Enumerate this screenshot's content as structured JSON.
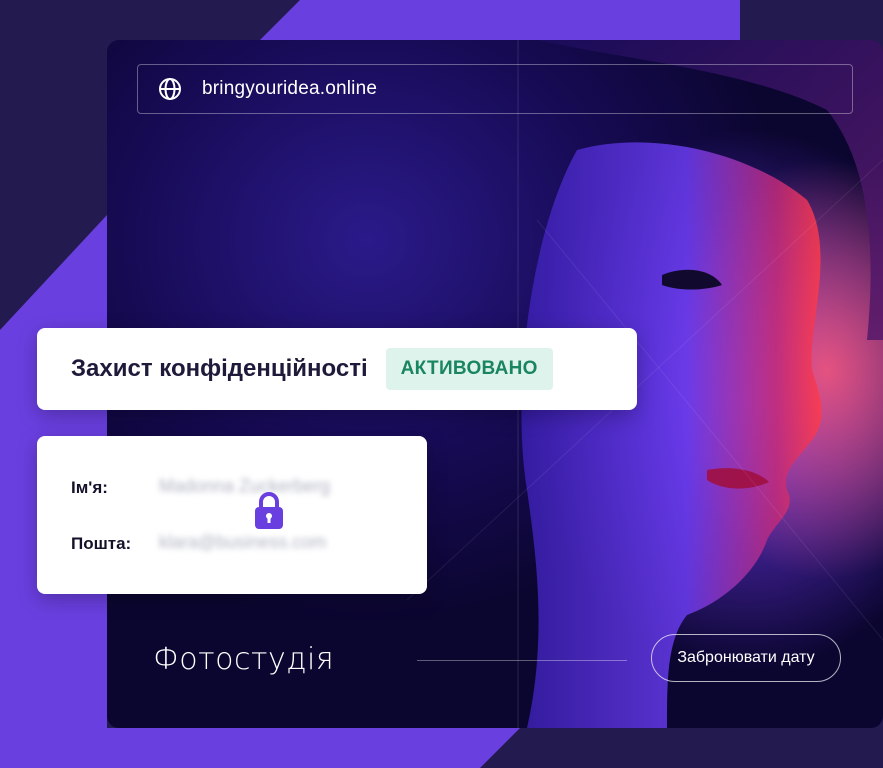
{
  "browser": {
    "url": "bringyouridea.online",
    "icon": "globe-icon"
  },
  "privacy": {
    "title": "Захист конфіденційності",
    "status": "АКТИВОВАНО",
    "status_color": "#1a8660",
    "status_bg": "#def3ec"
  },
  "form": {
    "name_label": "Ім'я:",
    "name_value": "Madonna Zuckerberg",
    "email_label": "Пошта:",
    "email_value": "klara@business.com",
    "lock_icon": "lock-icon"
  },
  "footer": {
    "studio_title": "Фотостудія",
    "book_button": "Забронювати дату"
  },
  "colors": {
    "accent": "#6a3fe0",
    "background_dark": "#231a4f"
  }
}
